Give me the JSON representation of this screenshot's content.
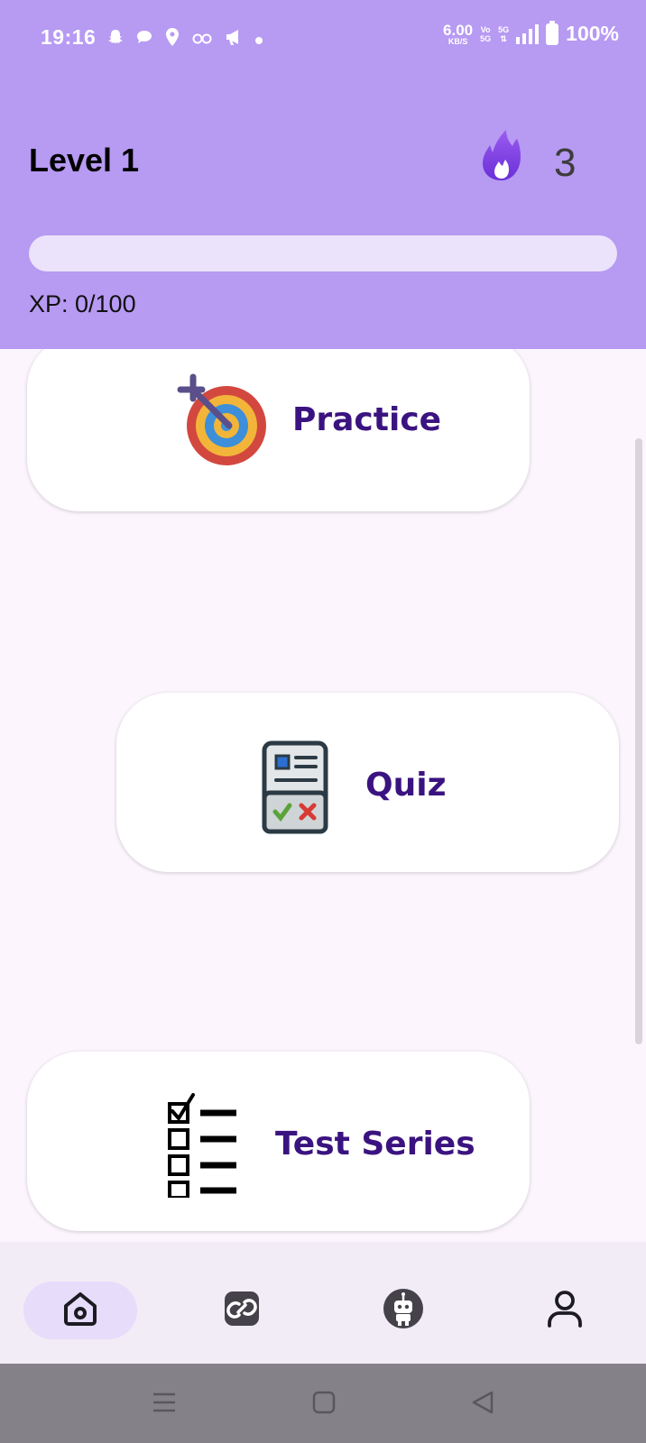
{
  "status_bar": {
    "time": "19:16",
    "net_speed_value": "6.00",
    "net_speed_unit": "KB/S",
    "volte_line1": "Vo",
    "volte_line2": "5G",
    "network_type": "5G",
    "battery": "100%",
    "notification_icons": [
      "snapchat-icon",
      "chat-bubble-icon",
      "location-pin-icon",
      "infinity-icon",
      "megaphone-icon",
      "dot-icon"
    ]
  },
  "header": {
    "level_title": "Level 1",
    "streak_count": "3",
    "streak_icon": "flame-icon",
    "xp_label": "XP: 0/100",
    "xp_progress": 0
  },
  "cards": {
    "practice": {
      "label": "Practice",
      "icon": "target-icon"
    },
    "quiz": {
      "label": "Quiz",
      "icon": "quiz-sheet-icon"
    },
    "test_series": {
      "label": "Test Series",
      "icon": "checklist-icon"
    }
  },
  "bottom_nav": {
    "items": [
      {
        "icon": "home-icon",
        "active": true
      },
      {
        "icon": "link-icon",
        "active": false
      },
      {
        "icon": "robot-icon",
        "active": false
      },
      {
        "icon": "profile-icon",
        "active": false
      }
    ]
  },
  "system_nav": [
    "menu-icon",
    "home-square-icon",
    "back-triangle-icon"
  ],
  "colors": {
    "header_bg": "#b79af2",
    "progress_track": "#ebe3fb",
    "card_label": "#3b1380",
    "page_bg": "#fcf5fd",
    "nav_bg": "#f2ecf6",
    "nav_active": "#e7dcfa",
    "system_nav_bg": "#858188"
  }
}
